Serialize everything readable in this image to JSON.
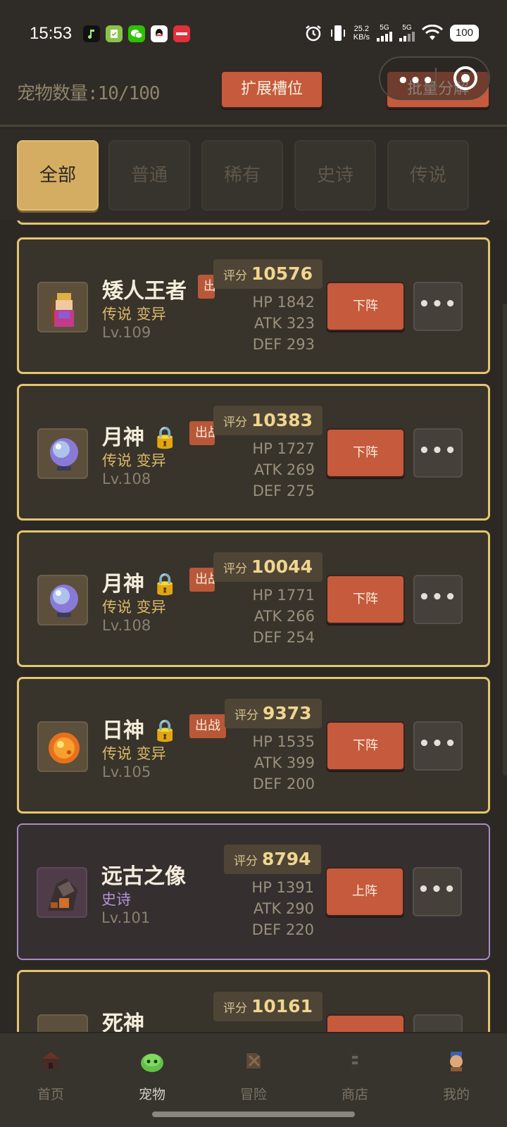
{
  "status_bar": {
    "time": "15:53",
    "apps": [
      "music-app",
      "tasks-app",
      "wechat-app",
      "qq-app",
      "xiaohongshu-app"
    ],
    "net_speed_value": "25.2",
    "net_speed_unit": "KB/s",
    "signal_1": "5G",
    "signal_2": "5G",
    "battery": "100"
  },
  "header": {
    "pet_count": "宠物数量:10/100",
    "expand_label": "扩展槽位",
    "batch_label": "批量分解"
  },
  "tabs": [
    {
      "label": "全部",
      "active": true
    },
    {
      "label": "普通",
      "active": false
    },
    {
      "label": "稀有",
      "active": false
    },
    {
      "label": "史诗",
      "active": false
    },
    {
      "label": "传说",
      "active": false
    }
  ],
  "pets": [
    {
      "name": "矮人王者",
      "locked": false,
      "rarity": "传说 变异",
      "level": "Lv.109",
      "deploy_tag": "出战",
      "score_label": "评分",
      "score": "10576",
      "hp": "HP 1842",
      "atk": "ATK 323",
      "def": "DEF 293",
      "action": "下阵",
      "more": "•••",
      "icon": "dwarf-king-icon",
      "tier": "legend"
    },
    {
      "name": "月神",
      "locked": true,
      "rarity": "传说 变异",
      "level": "Lv.108",
      "deploy_tag": "出战",
      "score_label": "评分",
      "score": "10383",
      "hp": "HP 1727",
      "atk": "ATK 269",
      "def": "DEF 275",
      "action": "下阵",
      "more": "•••",
      "icon": "moon-orb-icon",
      "tier": "legend"
    },
    {
      "name": "月神",
      "locked": true,
      "rarity": "传说 变异",
      "level": "Lv.108",
      "deploy_tag": "出战",
      "score_label": "评分",
      "score": "10044",
      "hp": "HP 1771",
      "atk": "ATK 266",
      "def": "DEF 254",
      "action": "下阵",
      "more": "•••",
      "icon": "moon-orb-icon",
      "tier": "legend"
    },
    {
      "name": "日神",
      "locked": true,
      "rarity": "传说 变异",
      "level": "Lv.105",
      "deploy_tag": "出战",
      "score_label": "评分",
      "score": "9373",
      "hp": "HP 1535",
      "atk": "ATK 399",
      "def": "DEF 200",
      "action": "下阵",
      "more": "•••",
      "icon": "sun-orb-icon",
      "tier": "legend"
    },
    {
      "name": "远古之像",
      "locked": false,
      "rarity": "史诗",
      "level": "Lv.101",
      "deploy_tag": "",
      "score_label": "评分",
      "score": "8794",
      "hp": "HP 1391",
      "atk": "ATK 290",
      "def": "DEF 220",
      "action": "上阵",
      "more": "•••",
      "icon": "ancient-statue-icon",
      "tier": "epic"
    },
    {
      "name": "死神",
      "locked": false,
      "rarity": "",
      "level": "",
      "deploy_tag": "",
      "score_label": "评分",
      "score": "10161",
      "hp": "",
      "atk": "",
      "def": "",
      "action": "",
      "more": "",
      "icon": "reaper-icon",
      "tier": "legend"
    }
  ],
  "bottom_nav": [
    {
      "label": "首页",
      "icon": "home-icon",
      "active": false
    },
    {
      "label": "宠物",
      "icon": "slime-pet-icon",
      "active": true
    },
    {
      "label": "冒险",
      "icon": "adventure-icon",
      "active": false
    },
    {
      "label": "商店",
      "icon": "shop-icon",
      "active": false
    },
    {
      "label": "我的",
      "icon": "profile-icon",
      "active": false
    }
  ],
  "colors": {
    "background": "#2c2925",
    "card": "#38332b",
    "legend_border": "#e5c570",
    "epic_border": "#a88ac6",
    "accent_orange": "#c65a3c",
    "tab_active": "#d5ad62"
  }
}
